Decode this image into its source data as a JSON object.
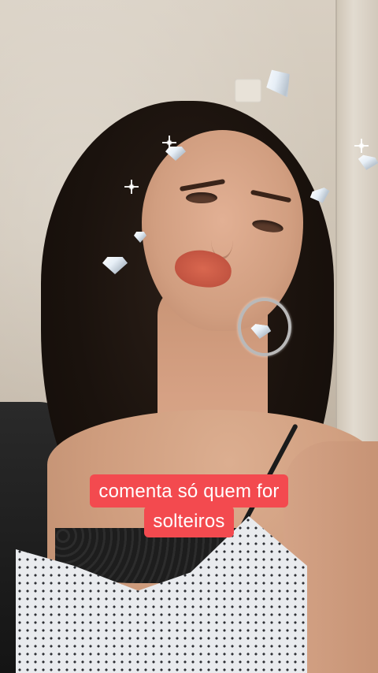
{
  "caption": {
    "line1": "comenta só quem for",
    "line2": "solteiros",
    "background_color": "#f34a4f",
    "text_color": "#ffffff"
  },
  "effects": {
    "sticker": "diamond-icon",
    "sparkle": "sparkle-icon"
  }
}
